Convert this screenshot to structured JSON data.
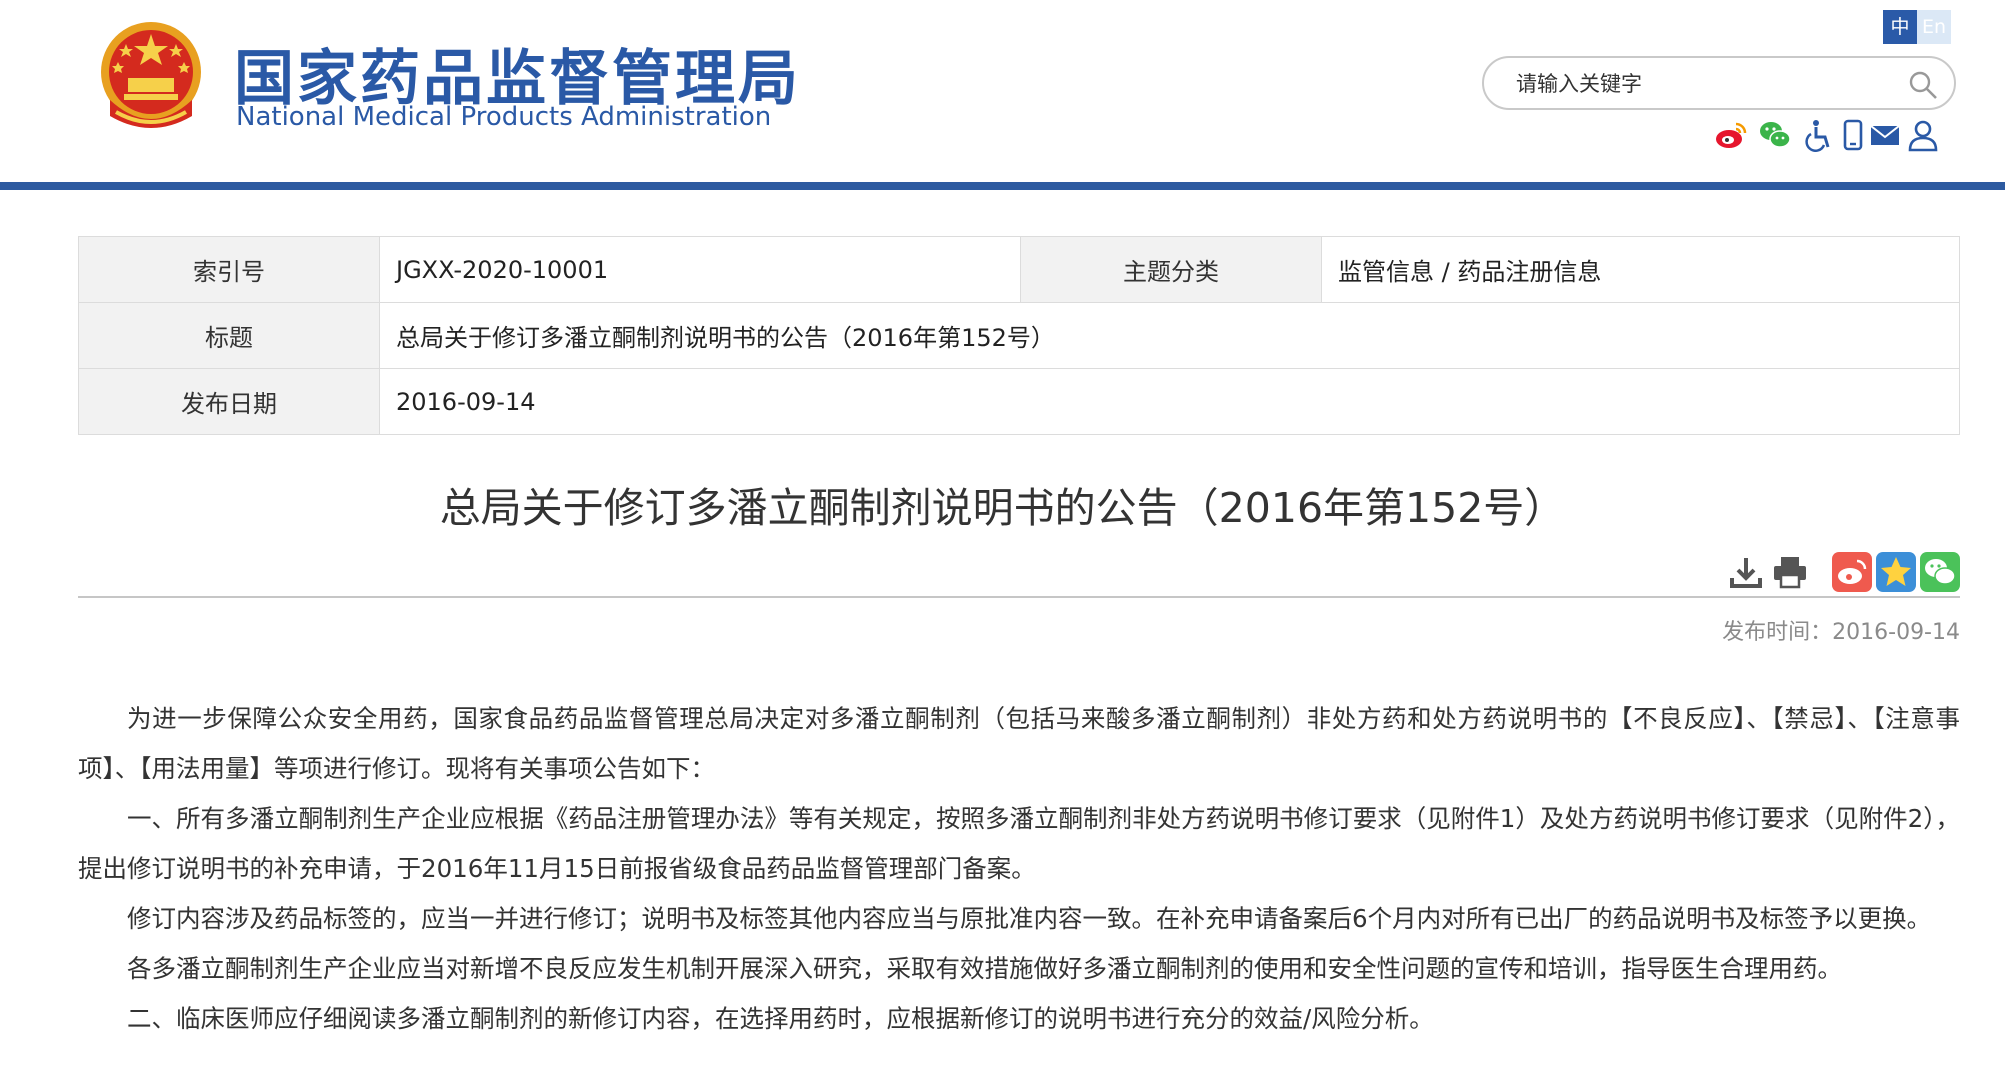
{
  "header": {
    "logo_cn": "国家药品监督管理局",
    "logo_en": "National Medical Products Administration",
    "lang_cn": "中",
    "lang_en": "En",
    "search_placeholder": "请输入关键字",
    "tools": [
      "weibo-icon",
      "wechat-icon",
      "accessibility-icon",
      "mobile-icon",
      "mail-icon",
      "user-icon"
    ],
    "colors": {
      "brand": "#2a59a6",
      "band": "#2d5aa0"
    }
  },
  "info": {
    "index_label": "索引号",
    "index_value": "JGXX-2020-10001",
    "topic_label": "主题分类",
    "topic_value": "监管信息 / 药品注册信息",
    "title_label": "标题",
    "title_value": "总局关于修订多潘立酮制剂说明书的公告（2016年第152号）",
    "date_label": "发布日期",
    "date_value": "2016-09-14"
  },
  "article": {
    "title": "总局关于修订多潘立酮制剂说明书的公告（2016年第152号）",
    "publish_time": "发布时间：2016-09-14",
    "actions": [
      "download-icon",
      "print-icon",
      "weibo-share-icon",
      "favorite-icon",
      "wechat-share-icon"
    ],
    "paragraphs": [
      "为进一步保障公众安全用药，国家食品药品监督管理总局决定对多潘立酮制剂（包括马来酸多潘立酮制剂）非处方药和处方药说明书的【不良反应】、【禁忌】、【注意事项】、【用法用量】等项进行修订。现将有关事项公告如下：",
      "一、所有多潘立酮制剂生产企业应根据《药品注册管理办法》等有关规定，按照多潘立酮制剂非处方药说明书修订要求（见附件1）及处方药说明书修订要求（见附件2），提出修订说明书的补充申请，于2016年11月15日前报省级食品药品监督管理部门备案。",
      "修订内容涉及药品标签的，应当一并进行修订；说明书及标签其他内容应当与原批准内容一致。在补充申请备案后6个月内对所有已出厂的药品说明书及标签予以更换。",
      "各多潘立酮制剂生产企业应当对新增不良反应发生机制开展深入研究，采取有效措施做好多潘立酮制剂的使用和安全性问题的宣传和培训，指导医生合理用药。",
      "二、临床医师应仔细阅读多潘立酮制剂的新修订内容，在选择用药时，应根据新修订的说明书进行充分的效益/风险分析。"
    ]
  }
}
